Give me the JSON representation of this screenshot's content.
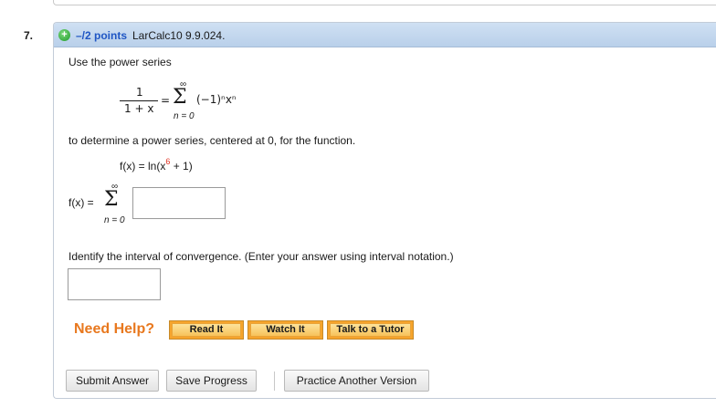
{
  "question": {
    "number": "7.",
    "points": "–/2 points",
    "source": "LarCalc10 9.9.024."
  },
  "prompt": {
    "intro": "Use the power series",
    "series_lhs_num": "1",
    "series_lhs_den": "1 + x",
    "equals": "=",
    "sum_upper": "∞",
    "sum_lower": "n = 0",
    "series_term": "(−1)ⁿxⁿ",
    "instruction": "to determine a power series, centered at 0, for the function.",
    "function_lhs": "f(x) = ln(x",
    "function_exponent": "6",
    "function_rhs": " + 1)"
  },
  "answer": {
    "lhs": "f(x) =",
    "sum_upper": "∞",
    "sum_lower": "n = 0",
    "series_value": "",
    "interval_prompt": "Identify the interval of convergence. (Enter your answer using interval notation.)",
    "interval_value": ""
  },
  "help": {
    "label": "Need Help?",
    "read_it": "Read It",
    "watch_it": "Watch It",
    "talk_to_tutor": "Talk to a Tutor"
  },
  "actions": {
    "submit": "Submit Answer",
    "save": "Save Progress",
    "practice": "Practice Another Version"
  }
}
